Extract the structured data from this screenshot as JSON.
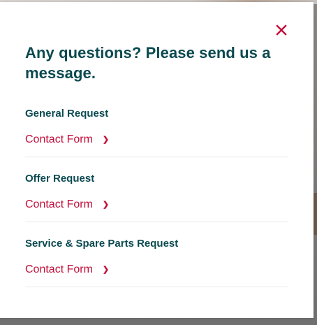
{
  "dialog": {
    "heading": "Any questions? Please send us a message.",
    "close_icon": "close-icon",
    "accent_color": "#c40f3a",
    "heading_color": "#0b4a50"
  },
  "sections": [
    {
      "title": "General Request",
      "link_label": "Contact Form",
      "link_icon": "chevron-right-icon",
      "chevron": "❯"
    },
    {
      "title": "Offer Request",
      "link_label": "Contact Form",
      "link_icon": "chevron-right-icon",
      "chevron": "❯"
    },
    {
      "title": "Service & Spare Parts Request",
      "link_label": "Contact Form",
      "link_icon": "chevron-right-icon",
      "chevron": "❯"
    }
  ]
}
